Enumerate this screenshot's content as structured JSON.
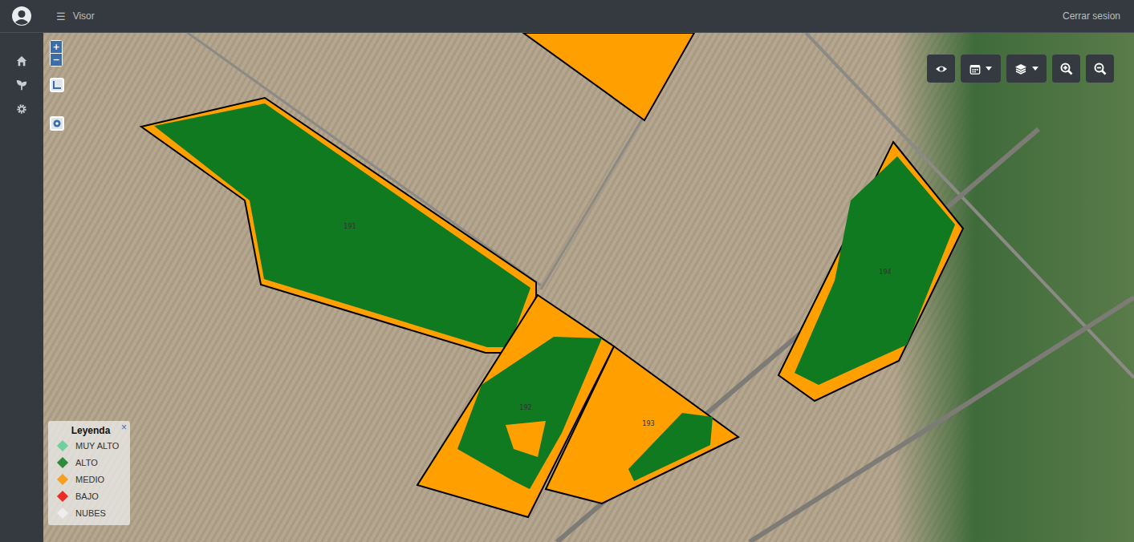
{
  "topbar": {
    "menu_icon": "☰",
    "title": "Visor",
    "logout": "Cerrar sesion"
  },
  "map_controls": {
    "zoom_in": "+",
    "zoom_out": "−"
  },
  "toolbar": {
    "buttons": [
      {
        "name": "eye",
        "kind": "plain"
      },
      {
        "name": "calendar",
        "kind": "dropdown"
      },
      {
        "name": "layers",
        "kind": "dropdown"
      },
      {
        "name": "zoom-in",
        "kind": "plain"
      },
      {
        "name": "zoom-out",
        "kind": "plain"
      }
    ]
  },
  "legend": {
    "title": "Leyenda",
    "close": "×",
    "items": [
      {
        "label": "MUY ALTO",
        "color": "#6fcf9f"
      },
      {
        "label": "ALTO",
        "color": "#2e8b3e"
      },
      {
        "label": "MEDIO",
        "color": "#f5a020"
      },
      {
        "label": "BAJO",
        "color": "#ee2a24"
      },
      {
        "label": "NUBES",
        "color": "#eeeeee"
      }
    ]
  },
  "parcels": [
    {
      "label": "",
      "color": "#ff9f00",
      "zone_color": "#ff9f00"
    },
    {
      "label": "191",
      "color": "#ff9f00",
      "zone_color": "#0f7a20"
    },
    {
      "label": "192",
      "color": "#ff9f00",
      "zone_color": "#0f7a20"
    },
    {
      "label": "193",
      "color": "#ff9f00",
      "zone_color": "#0f7a20"
    },
    {
      "label": "194",
      "color": "#ff9f00",
      "zone_color": "#0f7a20"
    }
  ]
}
